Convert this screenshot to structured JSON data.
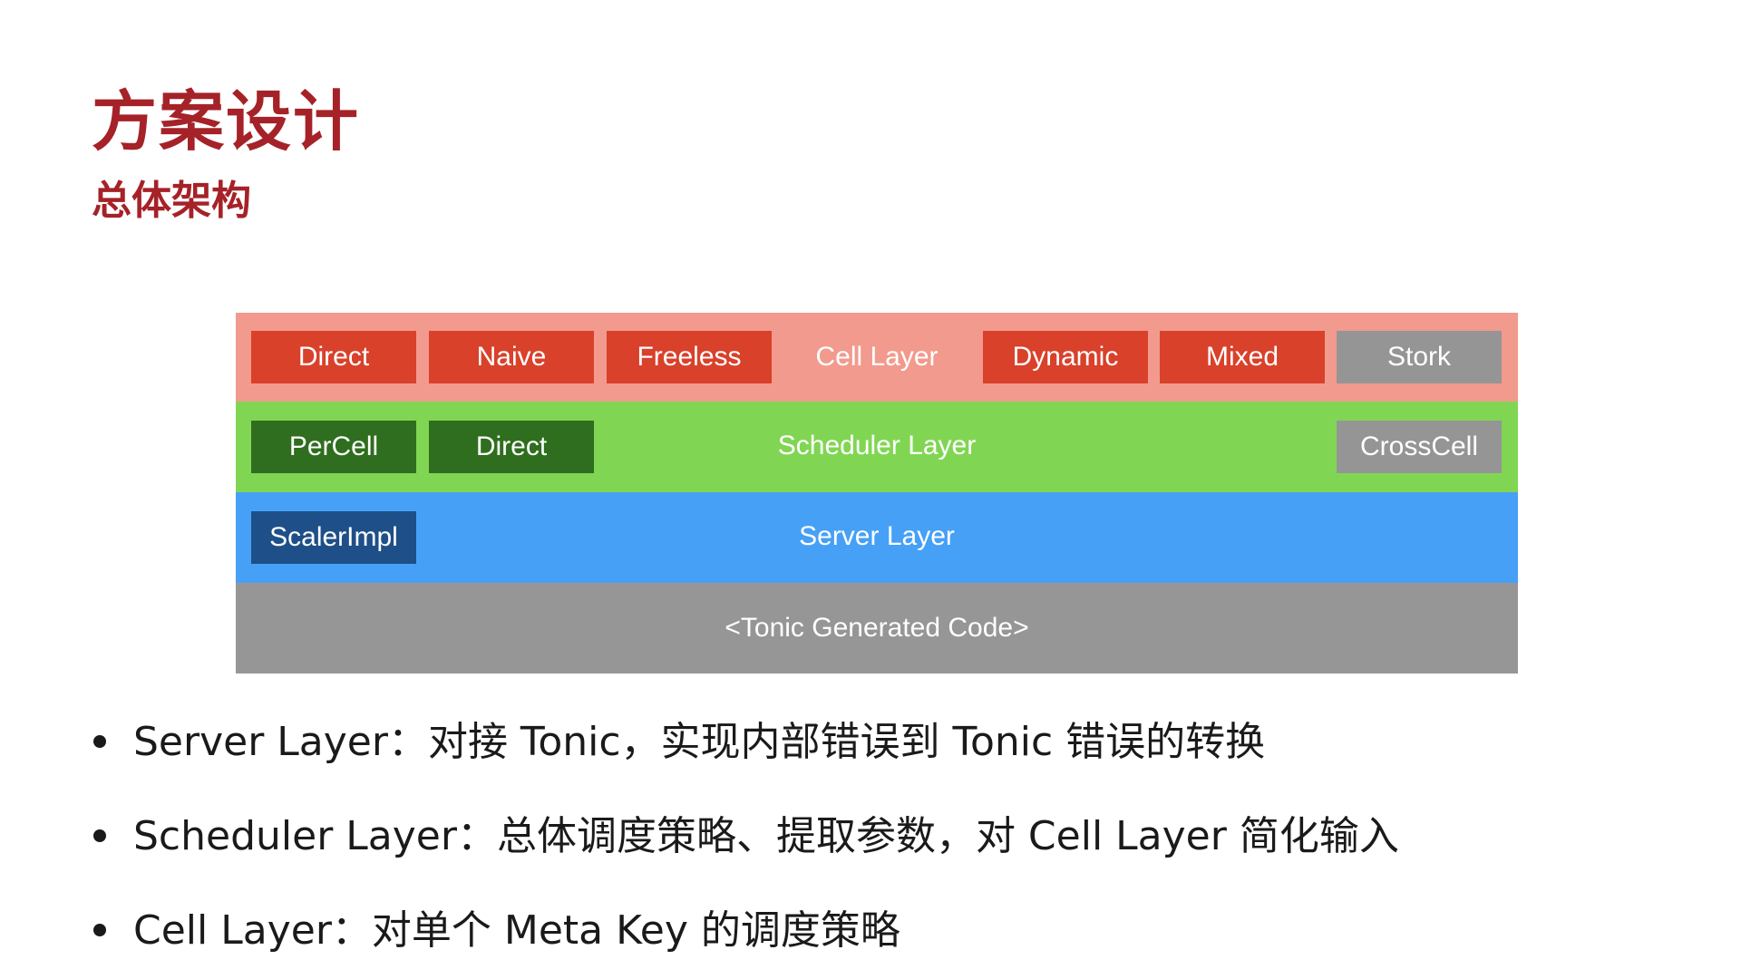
{
  "title": "方案设计",
  "subtitle": "总体架构",
  "colors": {
    "title": "#a52228",
    "cell_layer_bg": "#f29a8d",
    "cell_box": "#d9412b",
    "scheduler_layer_bg": "#80d653",
    "scheduler_box": "#2f6e1e",
    "server_layer_bg": "#46a0f6",
    "server_box": "#1e4f88",
    "tonic_layer_bg": "#969696",
    "gray_box": "#959595"
  },
  "layers": {
    "cell": {
      "label": "Cell Layer",
      "boxes": [
        {
          "label": "Direct",
          "color": "red"
        },
        {
          "label": "Naive",
          "color": "red"
        },
        {
          "label": "Freeless",
          "color": "red"
        },
        {
          "label": "Dynamic",
          "color": "red"
        },
        {
          "label": "Mixed",
          "color": "red"
        },
        {
          "label": "Stork",
          "color": "gray"
        }
      ]
    },
    "scheduler": {
      "label": "Scheduler Layer",
      "boxes": [
        {
          "label": "PerCell",
          "color": "green"
        },
        {
          "label": "Direct",
          "color": "green"
        },
        {
          "label": "CrossCell",
          "color": "gray"
        }
      ]
    },
    "server": {
      "label": "Server Layer",
      "boxes": [
        {
          "label": "ScalerImpl",
          "color": "blue"
        }
      ]
    },
    "tonic": {
      "label": "<Tonic Generated Code>"
    }
  },
  "bullets": [
    "Server Layer：对接 Tonic，实现内部错误到 Tonic 错误的转换",
    "Scheduler Layer：总体调度策略、提取参数，对 Cell Layer 简化输入",
    "Cell Layer：对单个 Meta Key 的调度策略"
  ]
}
